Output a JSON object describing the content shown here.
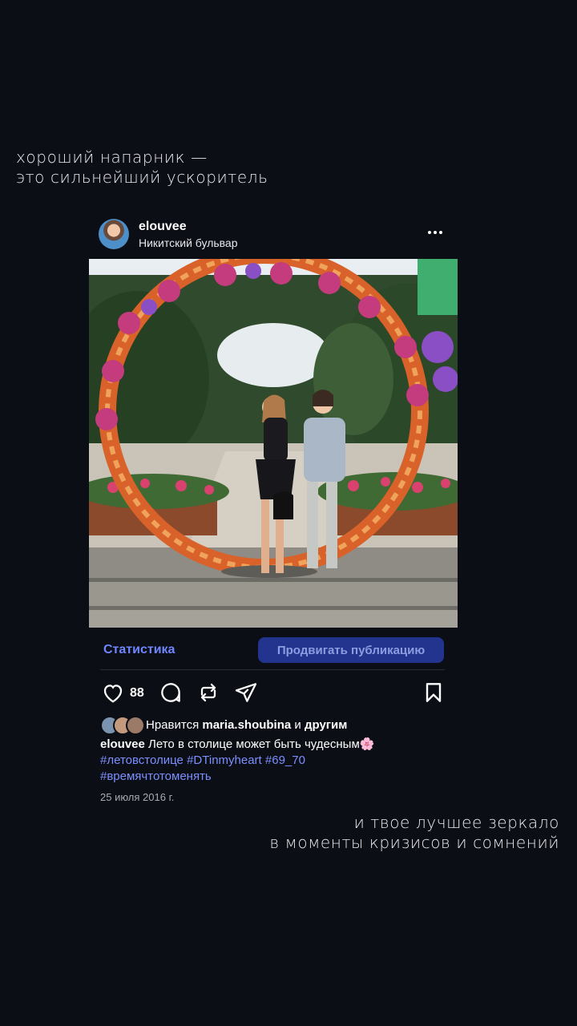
{
  "quotes": {
    "top_line1": "хороший напарник —",
    "top_line2": "это сильнейший ускоритель",
    "bottom_line1": "и твое лучшее зеркало",
    "bottom_line2": "в моменты кризисов и сомнений"
  },
  "post": {
    "username": "elouvee",
    "location": "Никитский бульвар",
    "stats_label": "Статистика",
    "promote_label": "Продвигать публикацию",
    "likes_count": "88",
    "liked_prefix": "Нравится",
    "liked_user": "maria.shoubina",
    "liked_conj": "и",
    "liked_others": "другим",
    "caption_user": "elouvee",
    "caption_text": "Лето в столице может быть чудесным🌸",
    "hashtags": [
      "#летовстолице",
      "#DTinmyheart",
      "#69_70",
      "#времячтотоменять"
    ],
    "date": "25 июля 2016 г."
  },
  "icons": {
    "more": "more-dots-icon",
    "like": "heart-icon",
    "comment": "comment-bubble-icon",
    "repost": "repost-icon",
    "share": "send-icon",
    "save": "bookmark-icon"
  },
  "colors": {
    "background": "#0b0e14",
    "link": "#6f86ff",
    "promote_bg": "#23348f",
    "hashtag": "#7b8fff"
  }
}
